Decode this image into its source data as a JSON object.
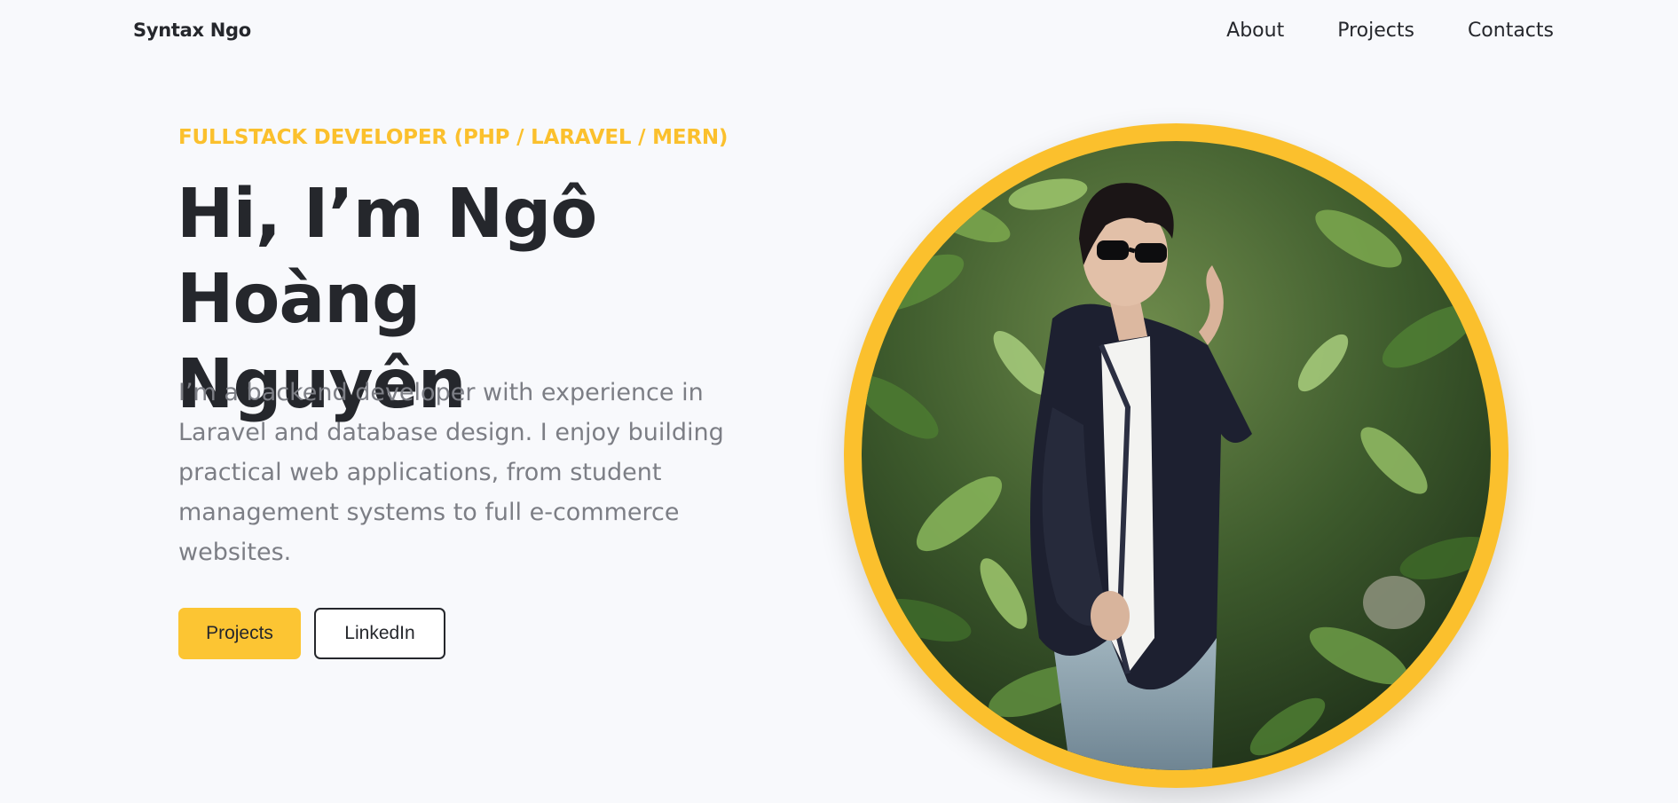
{
  "header": {
    "brand": "Syntax Ngo",
    "nav": [
      {
        "label": "About"
      },
      {
        "label": "Projects"
      },
      {
        "label": "Contacts"
      }
    ]
  },
  "hero": {
    "eyebrow": "FULLSTACK DEVELOPER (PHP / LARAVEL / MERN)",
    "headline_line1": "Hi, I’m Ngô",
    "headline_line2": "Hoàng Nguyên",
    "bio": "I’m a backend developer with experience in Laravel and database design. I enjoy building practical web applications, from student management systems to full e-commerce websites.",
    "buttons": {
      "primary": "Projects",
      "secondary": "LinkedIn"
    }
  },
  "colors": {
    "accent": "#fbc02d",
    "text": "#25272c",
    "muted": "#7c7e85",
    "background": "#f8f9fc"
  },
  "portrait": {
    "description_icon": "profile-photo"
  }
}
